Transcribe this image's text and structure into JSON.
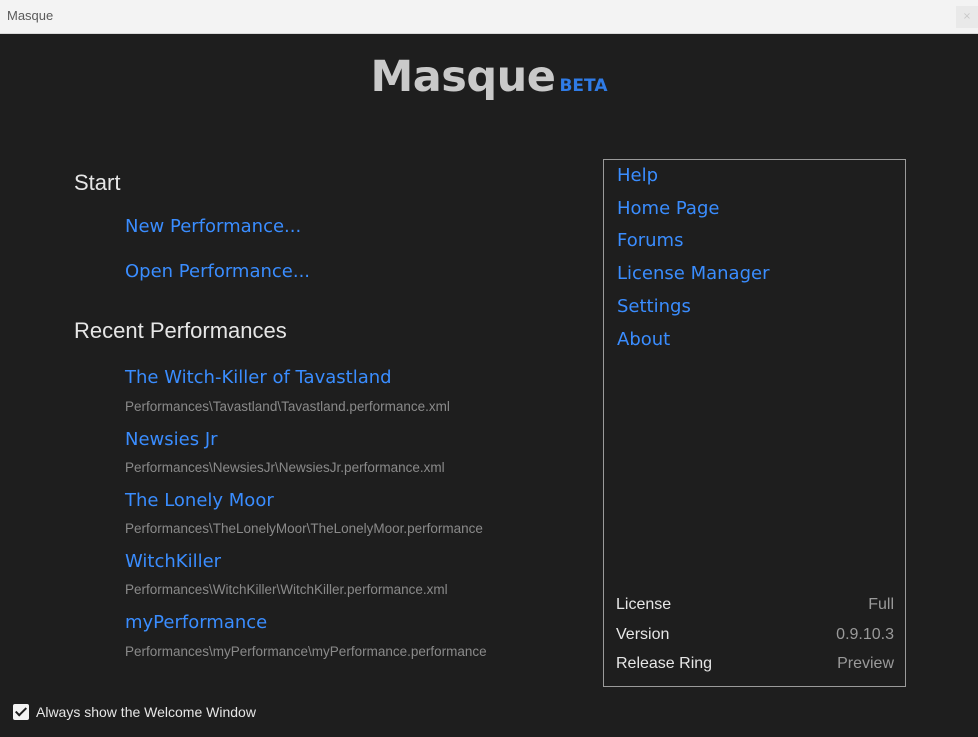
{
  "window": {
    "title": "Masque",
    "close_label": "×"
  },
  "header": {
    "app_name": "Masque",
    "badge": "BETA"
  },
  "start": {
    "heading": "Start",
    "new_label": "New Performance...",
    "open_label": "Open Performance..."
  },
  "recent": {
    "heading": "Recent Performances",
    "items": [
      {
        "name": "The Witch-Killer of Tavastland",
        "path": "Performances\\Tavastland\\Tavastland.performance.xml"
      },
      {
        "name": "Newsies Jr",
        "path": "Performances\\NewsiesJr\\NewsiesJr.performance.xml"
      },
      {
        "name": "The Lonely Moor",
        "path": "Performances\\TheLonelyMoor\\TheLonelyMoor.performance"
      },
      {
        "name": "WitchKiller",
        "path": "Performances\\WitchKiller\\WitchKiller.performance.xml"
      },
      {
        "name": "myPerformance",
        "path": "Performances\\myPerformance\\myPerformance.performance"
      }
    ]
  },
  "links": {
    "help": "Help",
    "home_page": "Home Page",
    "forums": "Forums",
    "license_manager": "License Manager",
    "settings": "Settings",
    "about": "About"
  },
  "info": {
    "license_label": "License",
    "license_value": "Full",
    "version_label": "Version",
    "version_value": "0.9.10.3",
    "ring_label": "Release Ring",
    "ring_value": "Preview"
  },
  "footer": {
    "checkbox_label": "Always show the Welcome Window",
    "checked": true
  },
  "colors": {
    "background": "#1e1e1e",
    "link": "#3a8dff",
    "beta": "#2f7be6",
    "heading": "#e6e6e6",
    "muted": "#8a8a8a"
  }
}
